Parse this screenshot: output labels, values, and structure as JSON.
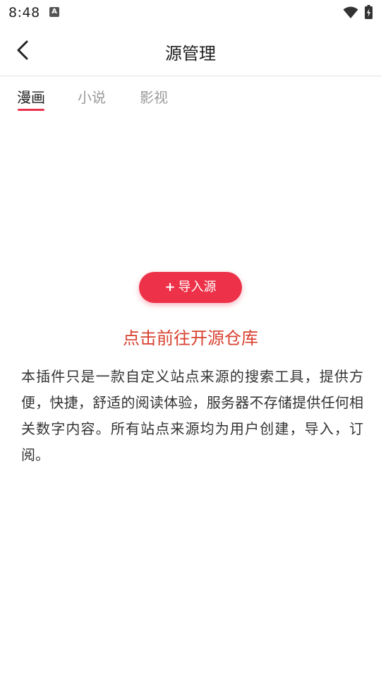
{
  "status_bar": {
    "time": "8:48",
    "app_icon_letter": "A",
    "icons": [
      "wifi-icon",
      "battery-charging-icon"
    ]
  },
  "header": {
    "title": "源管理",
    "back_icon": "chevron-left-icon"
  },
  "tabs": [
    {
      "label": "漫画",
      "active": true
    },
    {
      "label": "小说",
      "active": false
    },
    {
      "label": "影视",
      "active": false
    }
  ],
  "import_button": {
    "plus": "+",
    "label": "导入源"
  },
  "repo_link": "点击前往开源仓库",
  "disclaimer": "本插件只是一款自定义站点来源的搜索工具，提供方便，快捷，舒适的阅读体验，服务器不存储提供任何相关数字内容。所有站点来源均为用户创建，导入，订阅。",
  "colors": {
    "accent": "#ec3148",
    "link": "#d8402f",
    "text": "#333333",
    "tab_inactive": "#9a9a9a"
  }
}
